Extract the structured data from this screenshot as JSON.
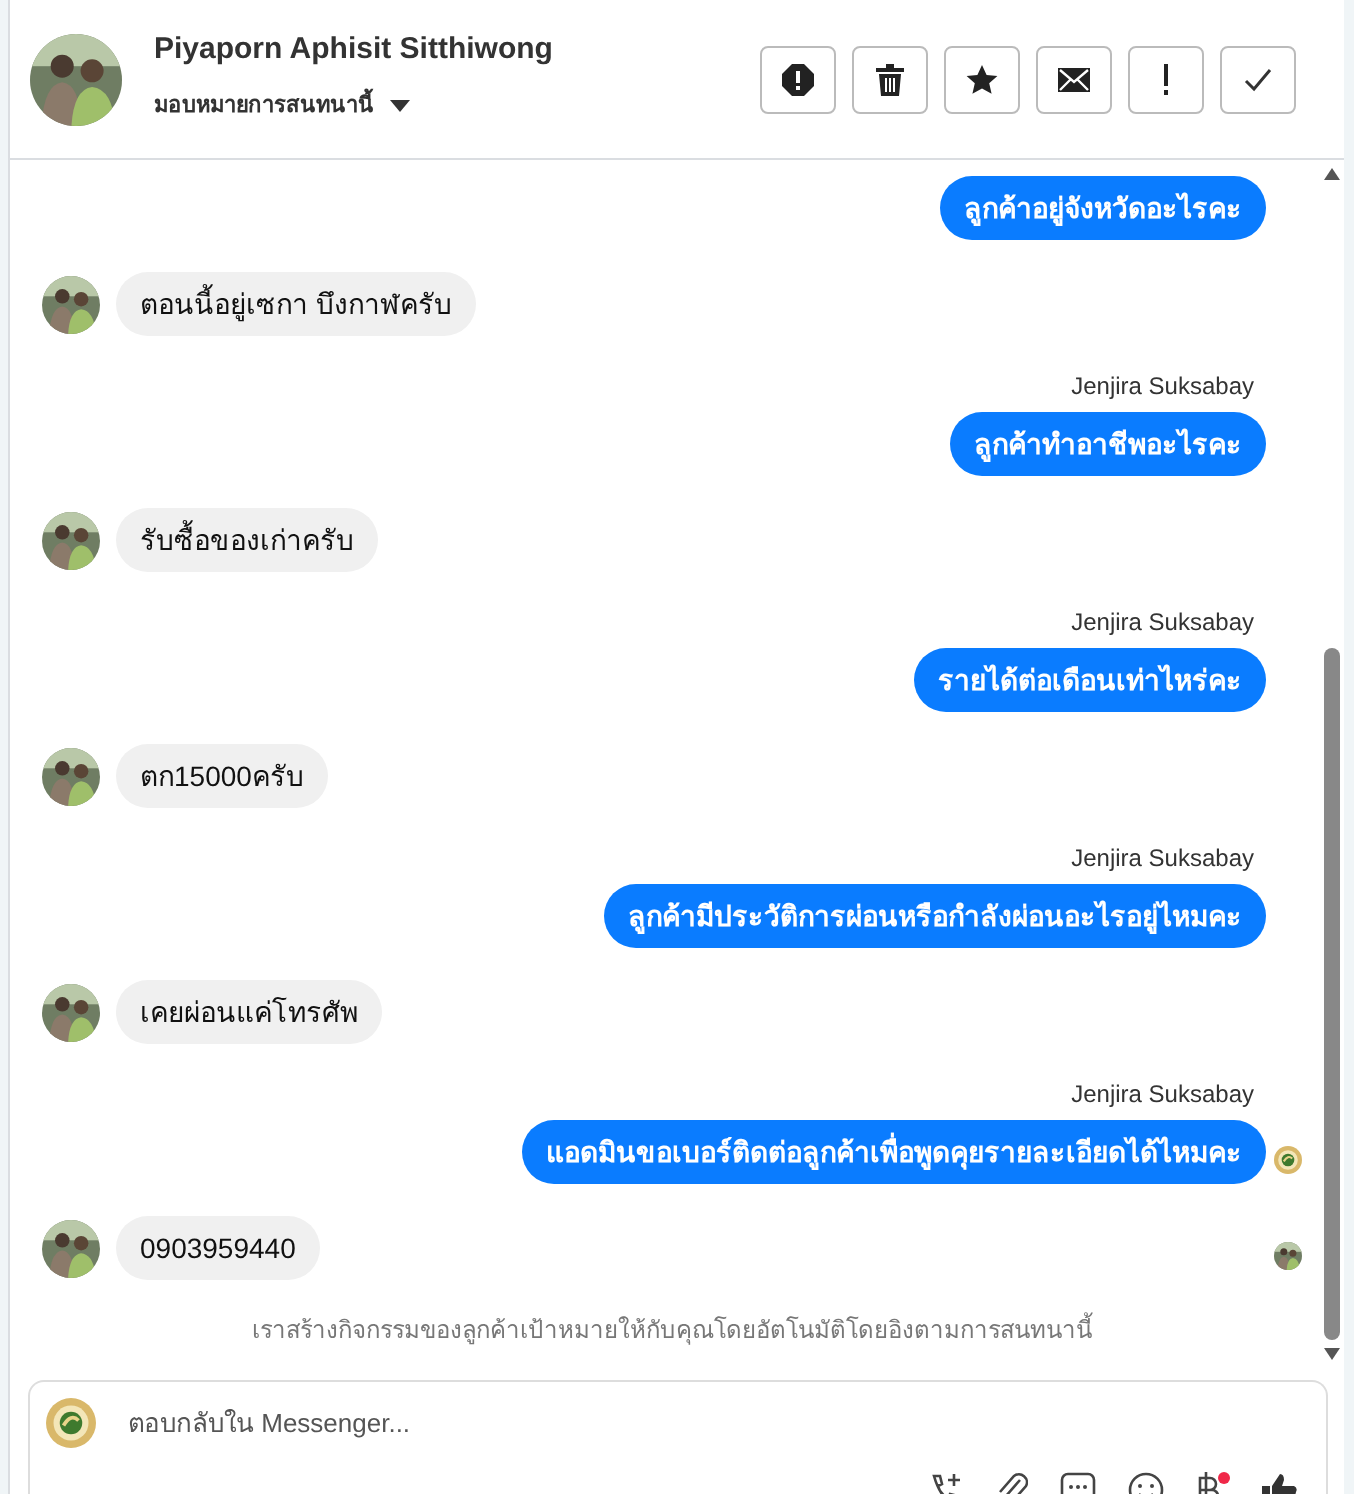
{
  "header": {
    "name": "Piyaporn Aphisit Sitthiwong",
    "assign_label": "มอบหมายการสนทนานี้",
    "actions": [
      {
        "kind": "spam"
      },
      {
        "kind": "trash"
      },
      {
        "kind": "star"
      },
      {
        "kind": "mail"
      },
      {
        "kind": "alert"
      },
      {
        "kind": "done"
      }
    ]
  },
  "messages": [
    {
      "kind": "outgoing",
      "text": "ลูกค้าอยู่จังหวัดอะไรคะ",
      "seen": false
    },
    {
      "kind": "incoming",
      "text": "ตอนนี้อยู่เซกา บึงกาฬครับ"
    },
    {
      "kind": "outgoing",
      "sender": "Jenjira Suksabay",
      "text": "ลูกค้าทำอาชีพอะไรคะ",
      "seen": false
    },
    {
      "kind": "incoming",
      "text": "รับซื้อของเก่าครับ"
    },
    {
      "kind": "outgoing",
      "sender": "Jenjira Suksabay",
      "text": "รายได้ต่อเดือนเท่าไหร่คะ",
      "seen": false
    },
    {
      "kind": "incoming",
      "text": "ตก15000ครับ"
    },
    {
      "kind": "outgoing",
      "sender": "Jenjira Suksabay",
      "text": "ลูกค้ามีประวัติการผ่อนหรือกำลังผ่อนอะไรอยู่ไหมคะ",
      "seen": false
    },
    {
      "kind": "incoming",
      "text": "เคยผ่อนแค่โทรศัพ"
    },
    {
      "kind": "outgoing",
      "sender": "Jenjira Suksabay",
      "text": "แอดมินขอเบอร์ติดต่อลูกค้าเพื่อพูดคุยรายละเอียดได้ไหมคะ",
      "seen": true
    },
    {
      "kind": "incoming",
      "text": "0903959440",
      "seen": true
    },
    {
      "kind": "notice",
      "text": "เราสร้างกิจกรรมของลูกค้าเป้าหมายให้กับคุณโดยอัตโนมัติโดยอิงตามการสนทนานี้"
    }
  ],
  "composer": {
    "placeholder": "ตอบกลับใน Messenger...",
    "tools": [
      {
        "kind": "call"
      },
      {
        "kind": "attach"
      },
      {
        "kind": "replies"
      },
      {
        "kind": "emoji"
      },
      {
        "kind": "payment",
        "badge": true
      },
      {
        "kind": "like"
      }
    ]
  }
}
